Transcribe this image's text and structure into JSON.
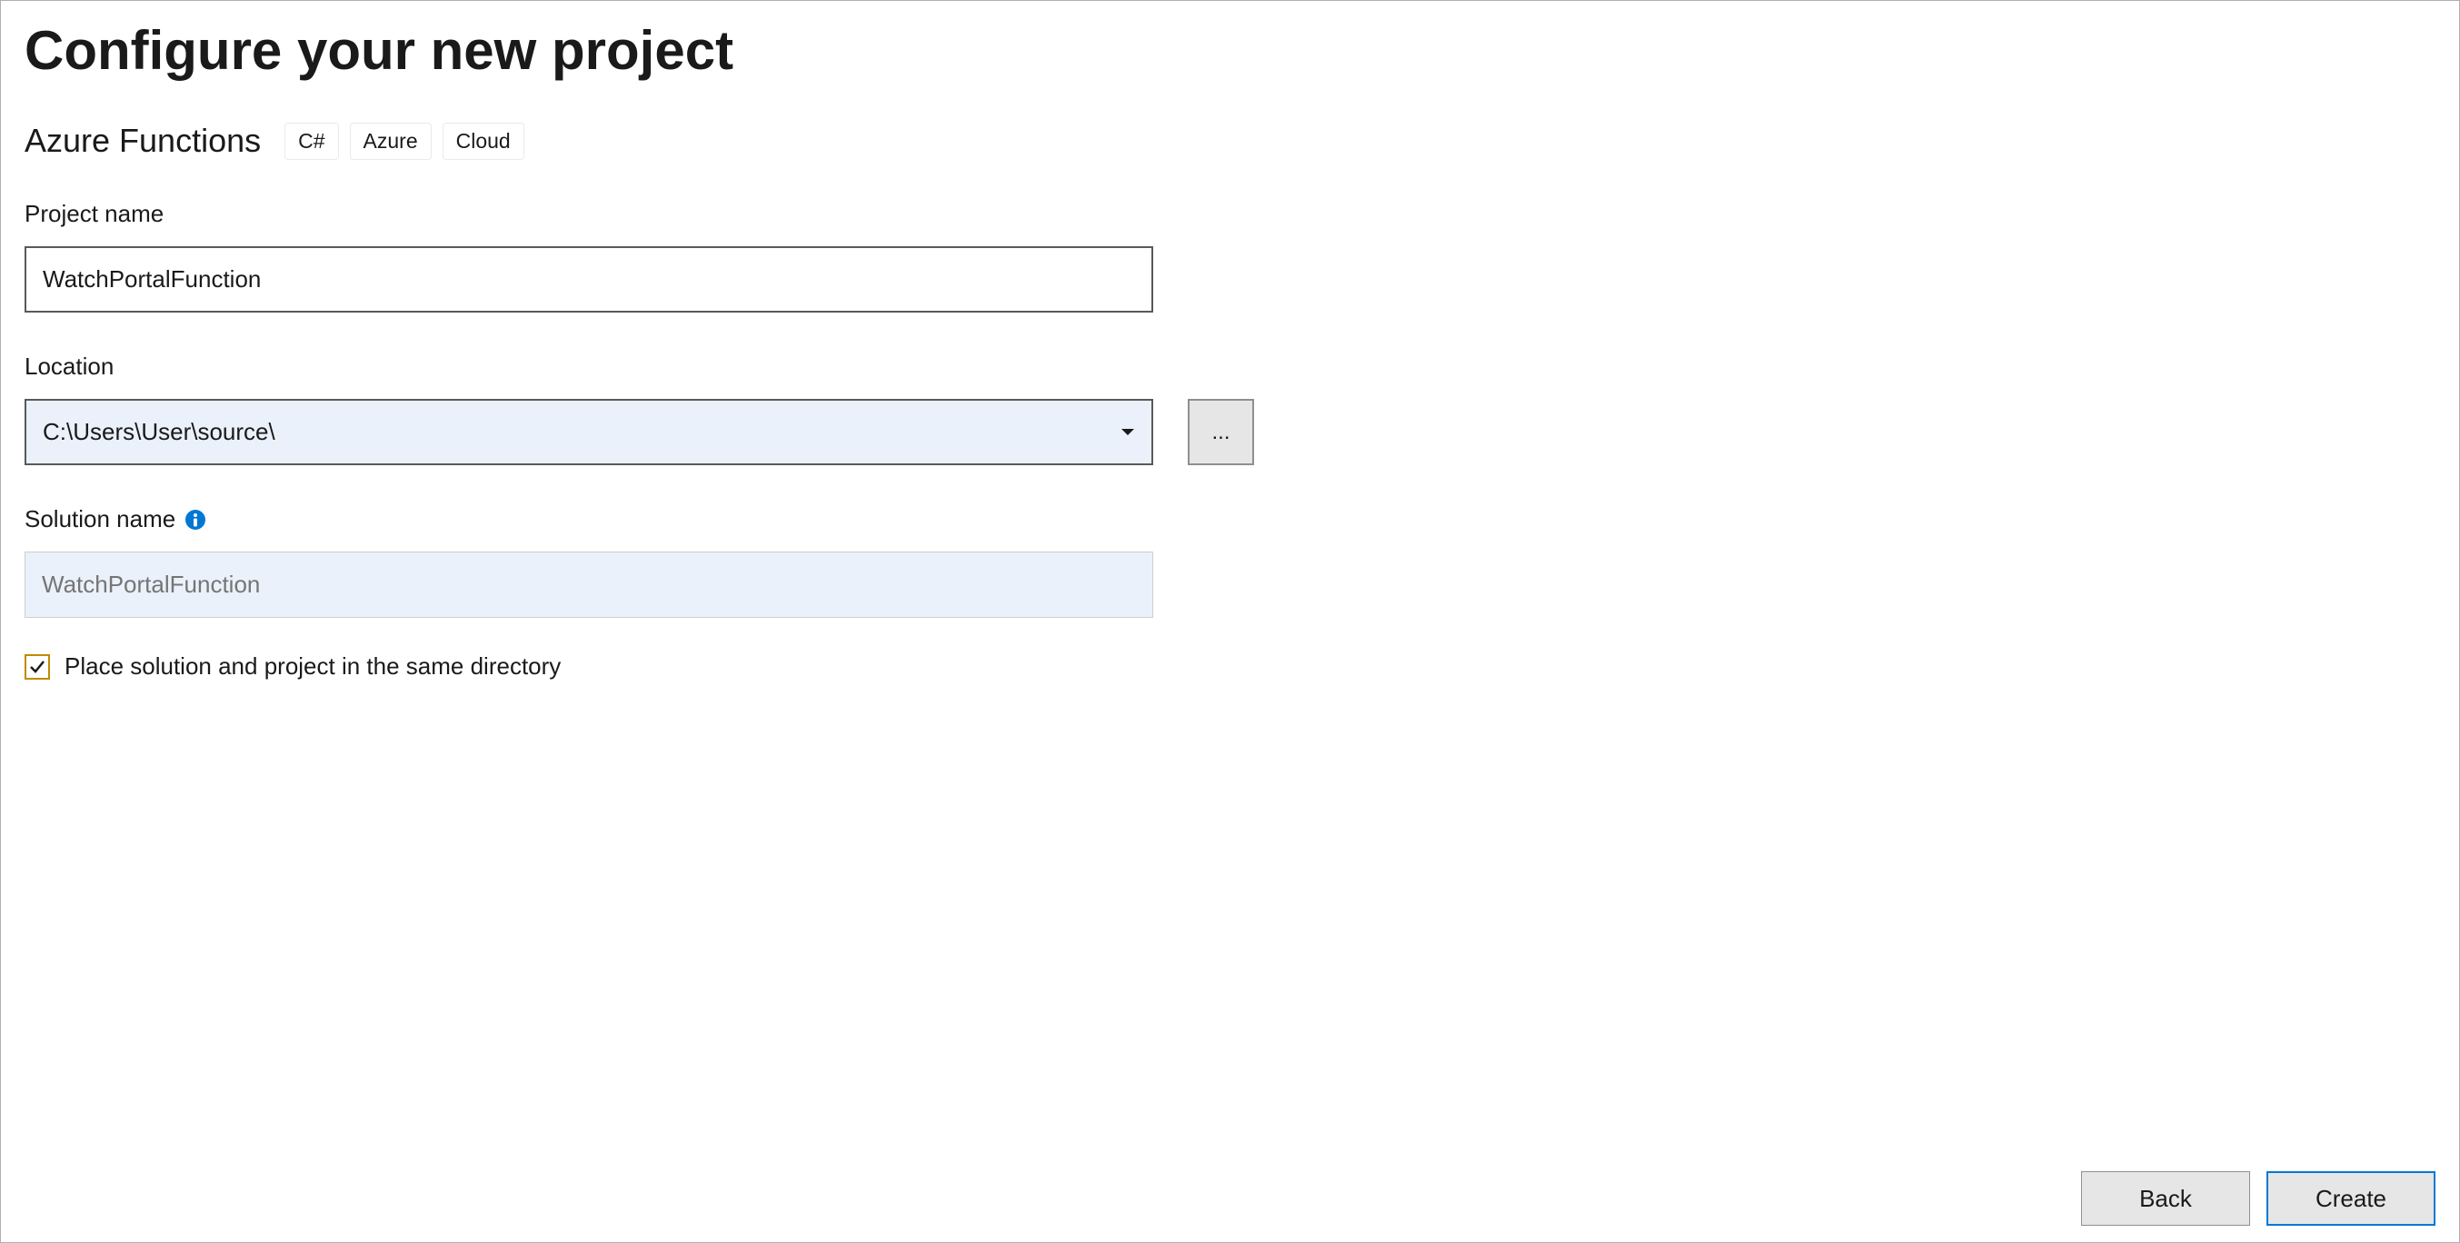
{
  "page": {
    "title": "Configure your new project",
    "subtitle": "Azure Functions",
    "tags": [
      "C#",
      "Azure",
      "Cloud"
    ]
  },
  "fields": {
    "project_name": {
      "label": "Project name",
      "value": "WatchPortalFunction"
    },
    "location": {
      "label": "Location",
      "value": "C:\\Users\\User\\source\\",
      "browse_label": "..."
    },
    "solution_name": {
      "label": "Solution name",
      "placeholder": "WatchPortalFunction",
      "disabled": true
    },
    "same_dir": {
      "label": "Place solution and project in the same directory",
      "checked": true
    }
  },
  "buttons": {
    "back": "Back",
    "create": "Create"
  }
}
